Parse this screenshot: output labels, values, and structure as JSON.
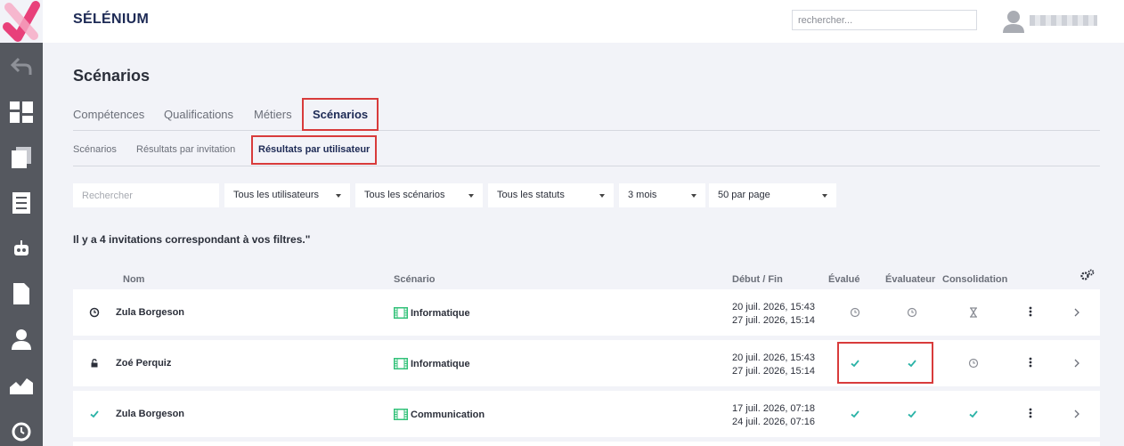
{
  "app": {
    "title": "SÉLÉNIUM"
  },
  "search": {
    "placeholder": "rechercher..."
  },
  "user": {
    "avatar_icon": "user-avatar-icon"
  },
  "sidebar": {
    "items": [
      {
        "icon": "back-arrow-icon"
      },
      {
        "icon": "dashboard-icon"
      },
      {
        "icon": "copy-pages-icon"
      },
      {
        "icon": "list-icon"
      },
      {
        "icon": "robot-icon"
      },
      {
        "icon": "document-icon"
      },
      {
        "icon": "user-icon"
      },
      {
        "icon": "area-chart-icon"
      },
      {
        "icon": "clock-icon"
      }
    ]
  },
  "page": {
    "title": "Scénarios"
  },
  "tabs": [
    {
      "label": "Compétences"
    },
    {
      "label": "Qualifications"
    },
    {
      "label": "Métiers"
    },
    {
      "label": "Scénarios",
      "active": true
    }
  ],
  "subtabs": [
    {
      "label": "Scénarios"
    },
    {
      "label": "Résultats par invitation"
    },
    {
      "label": "Résultats par utilisateur",
      "active": true
    }
  ],
  "filters": {
    "search_placeholder": "Rechercher",
    "users": "Tous les utilisateurs",
    "scenarios": "Tous les scénarios",
    "statuses": "Tous les statuts",
    "period": "3 mois",
    "per_page": "50 par page"
  },
  "results_text": "Il y a 4 invitations correspondant à vos filtres.\"",
  "table": {
    "headers": {
      "nom": "Nom",
      "scenario": "Scénario",
      "debut_fin": "Début / Fin",
      "evalue": "Évalué",
      "evaluateur": "Évaluateur",
      "consolidation": "Consolidation"
    },
    "rows": [
      {
        "status_icon": "clock-icon",
        "name": "Zula Borgeson",
        "scenario": "Informatique",
        "start": "20 juil. 2026, 15:43",
        "end": "27 juil. 2026, 15:14",
        "evalue": "pending",
        "evaluateur": "pending",
        "consolidation": "hourglass"
      },
      {
        "status_icon": "lock-icon",
        "name": "Zoé Perquiz",
        "scenario": "Informatique",
        "start": "20 juil. 2026, 15:43",
        "end": "27 juil. 2026, 15:14",
        "evalue": "done",
        "evaluateur": "done",
        "consolidation": "pending"
      },
      {
        "status_icon": "check-icon",
        "name": "Zula Borgeson",
        "scenario": "Communication",
        "start": "17 juil. 2026, 07:18",
        "end": "24 juil. 2026, 07:16",
        "evalue": "done",
        "evaluateur": "done",
        "consolidation": "done"
      }
    ]
  },
  "colors": {
    "accent_red": "#d83b3b",
    "check_teal": "#2bb3a7",
    "scenario_green": "#33c27a",
    "brand_navy": "#1d2a55",
    "sidebar_bg": "#55585f",
    "logo_pink": "#e8407a"
  }
}
